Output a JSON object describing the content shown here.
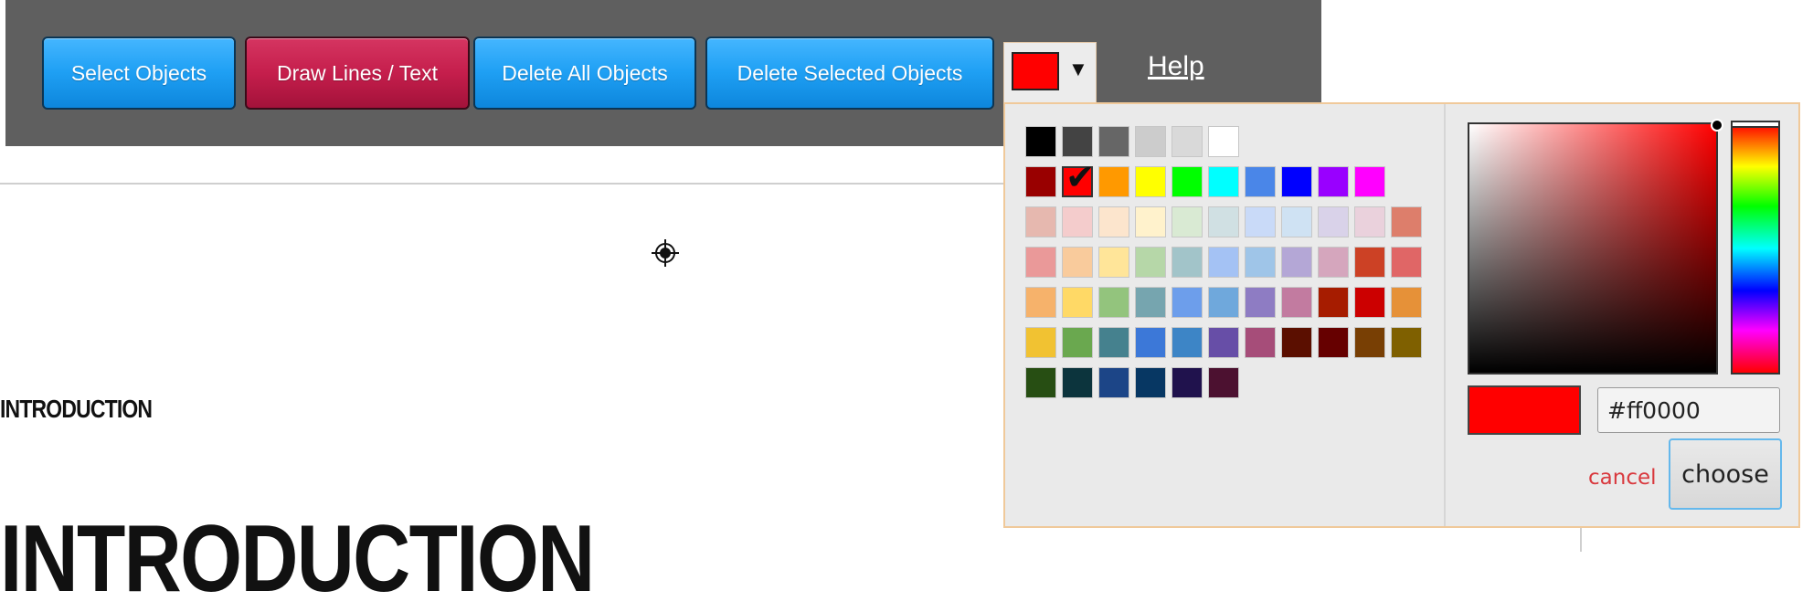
{
  "toolbar": {
    "select_objects_label": "Select Objects",
    "draw_lines_label": "Draw Lines / Text",
    "delete_all_label": "Delete All Objects",
    "delete_selected_label": "Delete Selected Objects",
    "current_color": "#ff0000",
    "dropdown_arrow": "▼",
    "help_label": "Help",
    "active_tool": "Draw Lines / Text"
  },
  "page": {
    "heading_small": "INTRODUCTION",
    "heading_large": "INTRODUCTION"
  },
  "picker": {
    "palette": [
      [
        "#000000",
        "#434343",
        "#666666",
        "#cccccc",
        "#d9d9d9",
        "#ffffff"
      ],
      [
        "#990000",
        "#ff0000",
        "#ff9900",
        "#ffff00",
        "#00ff00",
        "#00ffff",
        "#4a86e8",
        "#0000ff",
        "#9900ff",
        "#ff00ff"
      ],
      [
        "#e6b8af",
        "#f4cccc",
        "#fce5cd",
        "#fff2cc",
        "#d9ead3",
        "#d0e0e3",
        "#c9daf8",
        "#cfe2f3",
        "#d9d2e9",
        "#ead1dc",
        "#dd7e6b"
      ],
      [
        "#ea9999",
        "#f9cb9c",
        "#ffe599",
        "#b6d7a8",
        "#a2c4c9",
        "#a4c2f4",
        "#9fc5e8",
        "#b4a7d6",
        "#d5a6bd",
        "#cc4125",
        "#e06666"
      ],
      [
        "#f6b26b",
        "#ffd966",
        "#93c47d",
        "#76a5af",
        "#6d9eeb",
        "#6fa8dc",
        "#8e7cc3",
        "#c27ba0",
        "#a61c00",
        "#cc0000",
        "#e69138"
      ],
      [
        "#f1c232",
        "#6aa84f",
        "#45818e",
        "#3c78d8",
        "#3d85c6",
        "#674ea7",
        "#a64d79",
        "#5b0f00",
        "#660000",
        "#783f04",
        "#7f6000"
      ],
      [
        "#274e13",
        "#0c343d",
        "#1c4587",
        "#073763",
        "#20124d",
        "#4c1130"
      ]
    ],
    "selected_swatch": "#ff0000",
    "base_hue_color": "#ff0000",
    "hex_value": "#ff0000",
    "hex_display": "#ff0000",
    "cancel_label": "cancel",
    "choose_label": "choose"
  }
}
